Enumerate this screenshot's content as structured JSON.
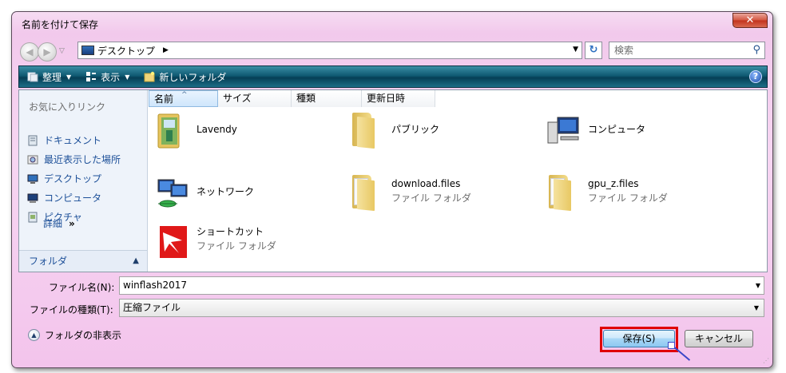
{
  "window": {
    "title": "名前を付けて保存",
    "close_label": "✕"
  },
  "address": {
    "location": "デスクトップ",
    "search_placeholder": "検索"
  },
  "toolbar": {
    "organize": "整理",
    "views": "表示",
    "new_folder": "新しいフォルダ",
    "help": "?"
  },
  "nav": {
    "favorites_title": "お気に入りリンク",
    "links": [
      "ドキュメント",
      "最近表示した場所",
      "デスクトップ",
      "コンピュータ",
      "ピクチャ"
    ],
    "more": "詳細",
    "more_chevron": "»",
    "folders": "フォルダ"
  },
  "columns": [
    "名前",
    "サイズ",
    "種類",
    "更新日時"
  ],
  "items": [
    {
      "name": "Lavendy",
      "sub": ""
    },
    {
      "name": "パブリック",
      "sub": ""
    },
    {
      "name": "コンピュータ",
      "sub": ""
    },
    {
      "name": "ネットワーク",
      "sub": ""
    },
    {
      "name": "download.files",
      "sub": "ファイル フォルダ"
    },
    {
      "name": "gpu_z.files",
      "sub": "ファイル フォルダ"
    },
    {
      "name": "ショートカット",
      "sub": "ファイル フォルダ"
    }
  ],
  "form": {
    "filename_label": "ファイル名(N):",
    "filename_value": "winflash2017",
    "filetype_label": "ファイルの種類(T):",
    "filetype_value": "圧縮ファイル",
    "hide_folders": "フォルダの非表示",
    "save": "保存(S)",
    "cancel": "キャンセル"
  },
  "colors": {
    "toolbar": "#0f5a73",
    "highlight": "#e00000",
    "link": "#1c4f98"
  }
}
